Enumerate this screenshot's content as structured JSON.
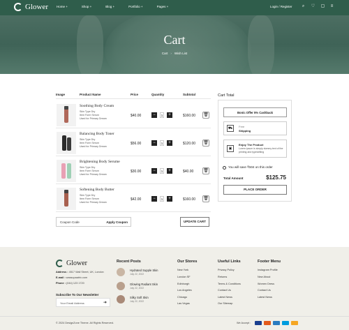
{
  "header": {
    "brand": "Glower",
    "nav": [
      "Home +",
      "Shop +",
      "Blog +",
      "Portfolio +",
      "Pages +"
    ],
    "login": "Login / Register",
    "icons": [
      "search-icon",
      "heart-icon",
      "bag-icon",
      "menu-icon"
    ]
  },
  "hero": {
    "title": "Cart",
    "crumbs": [
      "Cart",
      "Wish List"
    ]
  },
  "cart": {
    "headers": [
      "Image",
      "Product Name",
      "Price",
      "Quantity",
      "Subtotal"
    ],
    "items": [
      {
        "name": "Soothing Body Cream",
        "meta": [
          "Skin Type Dry",
          "Item Form Serum",
          "Used for Primary Dream"
        ],
        "price": "$40.00",
        "qty": "1",
        "subtotal": "$160.00",
        "color": "#b0685a"
      },
      {
        "name": "Balancing Body Toner",
        "meta": [
          "Skin Type Dry",
          "Item Form Serum",
          "Used for Primary Dream"
        ],
        "price": "$56.00",
        "qty": "1",
        "subtotal": "$120.00",
        "color": "#2a2a2a"
      },
      {
        "name": "Brightening Body Serume",
        "meta": [
          "Skin Type Dry",
          "Item Form Serum",
          "Used for Primary Dream"
        ],
        "price": "$30.00",
        "qty": "1",
        "subtotal": "$40.00",
        "color": "#e8a0b4"
      },
      {
        "name": "Softening Body Butter",
        "meta": [
          "Skin Type Dry",
          "Item Form Serum",
          "Used for Primary Dream"
        ],
        "price": "$42.00",
        "qty": "1",
        "subtotal": "$160.00",
        "color": "#a8604f"
      }
    ],
    "coupon_placeholder": "Coupon Code",
    "apply": "Apply Coupon",
    "update": "UPDATE CART"
  },
  "totals": {
    "title": "Cart Total",
    "offer": "Bonic Offer 5% Cashback",
    "shipping_free": "Free",
    "shipping": "Shipping",
    "enjoy": "Enjoy The Product",
    "enjoy_desc": "Lorem ipsum is simply dummy text of the printing and typesetting",
    "save": "You will save ₹504 on this order",
    "total_label": "Total Amount",
    "total_value": "$125.75",
    "place": "PLACE ORDER"
  },
  "footer": {
    "brand": "Glower",
    "address_label": "Address :",
    "address": "4517 Wall Street, UK, London",
    "email_label": "E-mail :",
    "email": "wassupaatrix.com",
    "phone_label": "Phone :",
    "phone": "(044) 123 1720",
    "newsletter": "Subscribe To Our Newsletter",
    "email_placeholder": "Your Email Address",
    "posts_title": "Recent Posts",
    "posts": [
      {
        "title": "Hydrated Supple Skin",
        "date": "July 22, 2022"
      },
      {
        "title": "Glowing Radiant Skin",
        "date": "July 22, 2022"
      },
      {
        "title": "Silky Soft Skin",
        "date": "July 22, 2022"
      }
    ],
    "stores_title": "Our Stores",
    "stores": [
      "New York",
      "London SF",
      "Edinburgh",
      "Los Angeles",
      "Chicago",
      "Las Vegas"
    ],
    "useful_title": "Useful Links",
    "useful": [
      "Privacy Policy",
      "Returns",
      "Terms & Conditions",
      "Contact Us",
      "Latest News",
      "Our Sitemap"
    ],
    "menu_title": "Footer Menu",
    "menu": [
      "Instagram Profile",
      "New Ahout",
      "Women Dress",
      "Contact Us",
      "Latest News"
    ],
    "copyright": "© 2024 DesignZone Theme. All Rights Reserved.",
    "we_accept": "We Accept :"
  },
  "colors": {
    "brand": "#2f5d4b",
    "footer_bg": "#f0efe9"
  }
}
